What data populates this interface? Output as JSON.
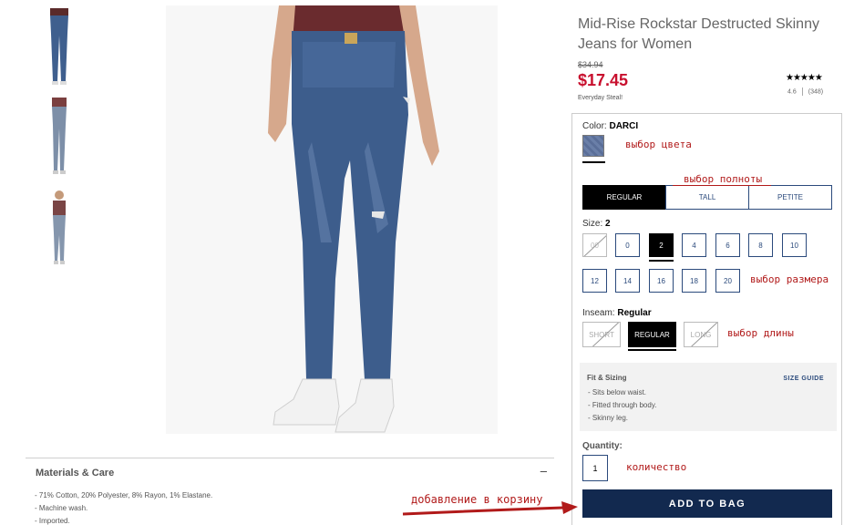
{
  "product": {
    "title": "Mid-Rise Rockstar Destructed Skinny Jeans for Women",
    "price_old": "$34.94",
    "price_new": "$17.45",
    "price_note": "Everyday Steal!",
    "rating_stars": "★★★★★",
    "rating_value": "4.6",
    "review_count": "(348)"
  },
  "color": {
    "label": "Color:",
    "value": "DARCI"
  },
  "fit": {
    "options": [
      "REGULAR",
      "TALL",
      "PETITE"
    ],
    "selected": "REGULAR"
  },
  "size": {
    "label": "Size:",
    "value": "2",
    "row1": [
      "00",
      "0",
      "2",
      "4",
      "6",
      "8",
      "10"
    ],
    "row2": [
      "12",
      "14",
      "16",
      "18",
      "20"
    ]
  },
  "inseam": {
    "label": "Inseam:",
    "value": "Regular",
    "options": [
      "SHORT",
      "REGULAR",
      "LONG"
    ]
  },
  "fit_sizing": {
    "title": "Fit & Sizing",
    "size_guide": "SIZE GUIDE",
    "items": [
      "Sits below waist.",
      "Fitted through body.",
      "Skinny leg."
    ]
  },
  "quantity": {
    "label": "Quantity:",
    "value": "1"
  },
  "add_to_bag": "ADD TO BAG",
  "materials": {
    "title": "Materials & Care",
    "toggle": "–",
    "items": [
      "71% Cotton, 20% Polyester, 8% Rayon, 1% Elastane.",
      "Machine wash.",
      "Imported."
    ]
  },
  "annotations": {
    "color": "выбор цвета",
    "fit": "выбор полноты",
    "size": "выбор размера",
    "inseam": "выбор длины",
    "quantity": "количество",
    "add": "добавление в корзину"
  },
  "colors": {
    "price_red": "#c8102e",
    "navy": "#12294f",
    "annotation": "#b11a1a"
  }
}
